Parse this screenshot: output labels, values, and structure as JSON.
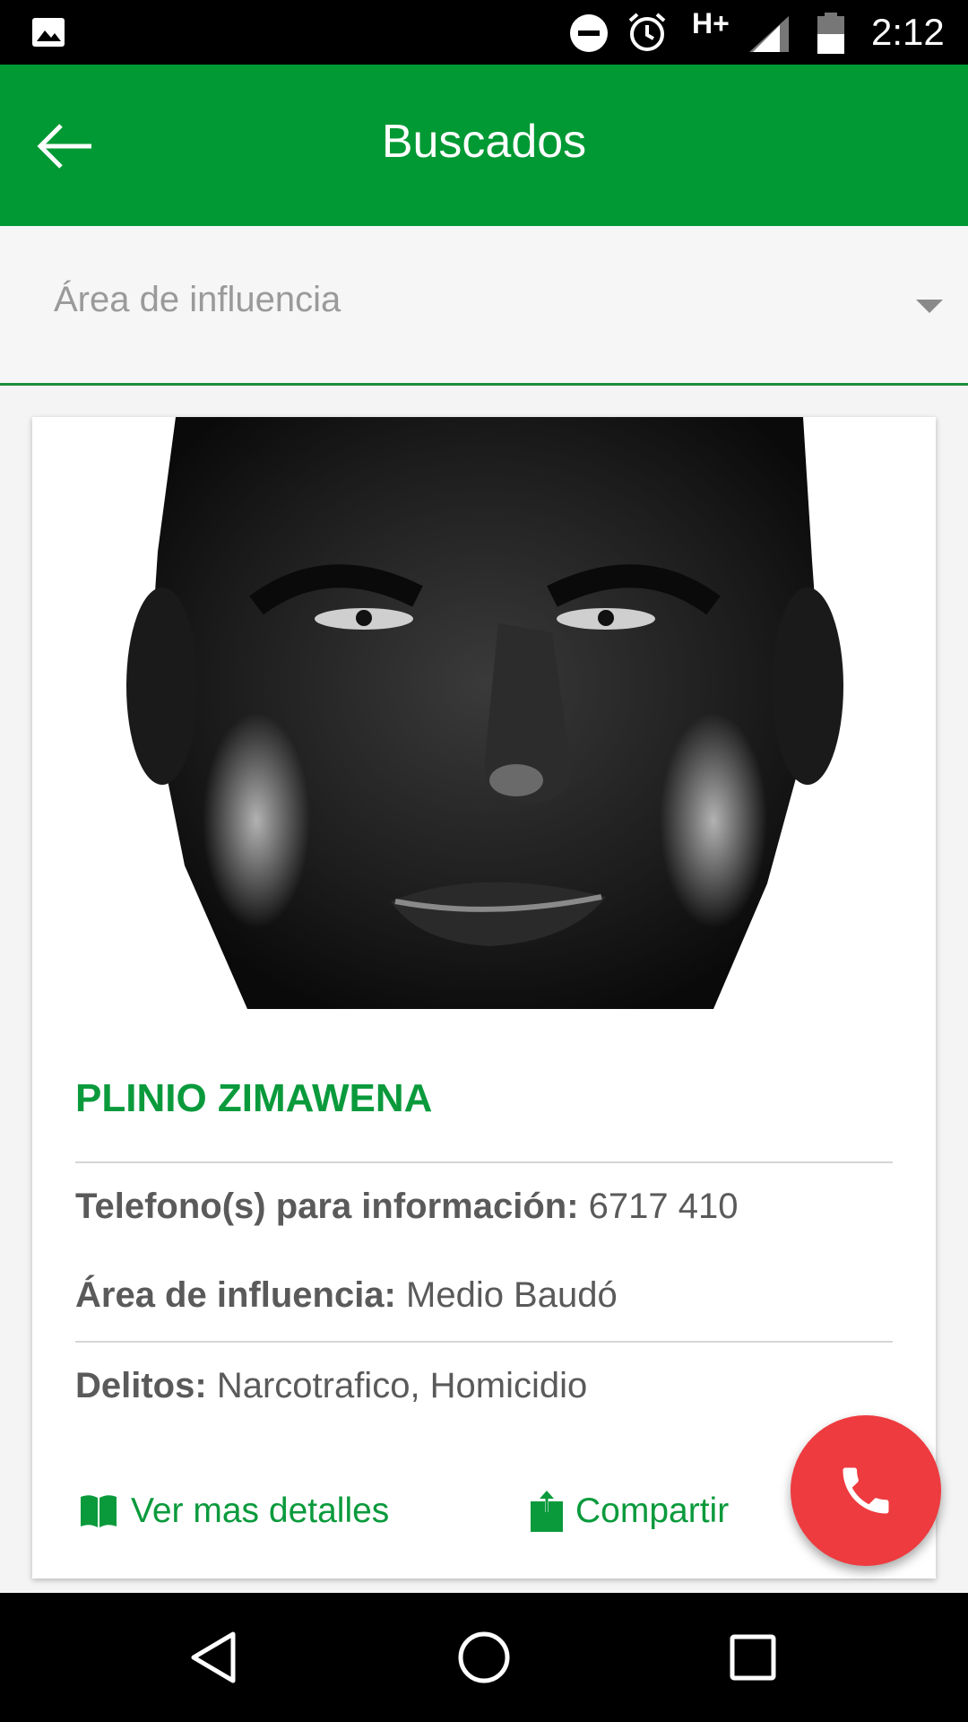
{
  "status_bar": {
    "network": "H+",
    "time": "2:12",
    "icons": [
      "gallery-icon",
      "do-not-disturb-icon",
      "alarm-icon",
      "signal-icon",
      "battery-icon"
    ]
  },
  "app_bar": {
    "title": "Buscados",
    "back_icon": "arrow-left-icon",
    "color": "#009933"
  },
  "filter": {
    "placeholder": "Área de influencia",
    "icon": "dropdown-caret-icon"
  },
  "card": {
    "name": "PLINIO ZIMAWENA",
    "phone_label": "Telefono(s) para información:",
    "phone_value": "6717 410",
    "area_label": "Área de influencia:",
    "area_value": "Medio Baudó",
    "crimes_label": "Delitos:",
    "crimes_value": "Narcotrafico, Homicidio",
    "details_label": "Ver mas detalles",
    "share_label": "Compartir",
    "accent": "#0a9a3c"
  },
  "fab": {
    "icon": "phone-icon",
    "color": "#ee3b3f"
  },
  "nav_bar": {
    "icons": [
      "nav-back-icon",
      "nav-home-icon",
      "nav-recents-icon"
    ]
  }
}
